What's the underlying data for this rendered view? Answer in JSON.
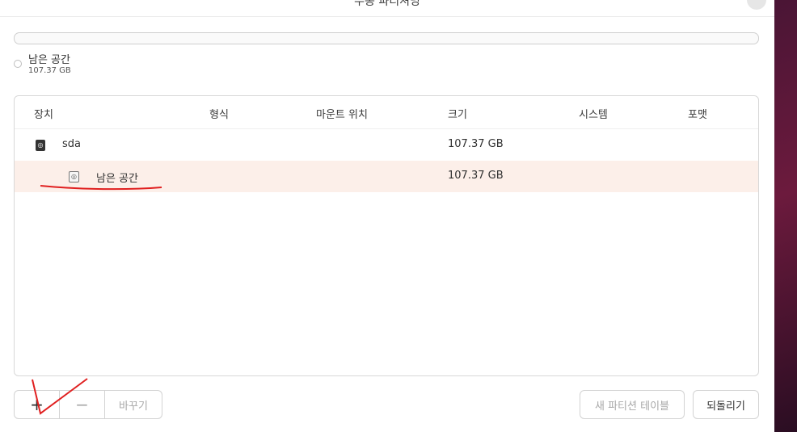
{
  "window": {
    "title": "수동 파티셔닝"
  },
  "usage": {
    "free_label": "남은 공간",
    "free_size": "107.37 GB"
  },
  "table": {
    "columns": [
      "장치",
      "형식",
      "마운트 위치",
      "크기",
      "시스템",
      "포맷"
    ],
    "rows": [
      {
        "device": "sda",
        "type": "",
        "mount": "",
        "size": "107.37 GB",
        "system": "",
        "format": ""
      },
      {
        "device": "남은 공간",
        "type": "",
        "mount": "",
        "size": "107.37 GB",
        "system": "",
        "format": ""
      }
    ]
  },
  "toolbar": {
    "add_label": "+",
    "remove_label": "−",
    "change_label": "바꾸기",
    "new_table_label": "새 파티션 테이블",
    "revert_label": "되돌리기"
  },
  "icons": {
    "disk": "hard-disk-icon",
    "close": "close-icon"
  },
  "colors": {
    "selected_row": "#fcefe9",
    "annotation": "#e02020"
  }
}
